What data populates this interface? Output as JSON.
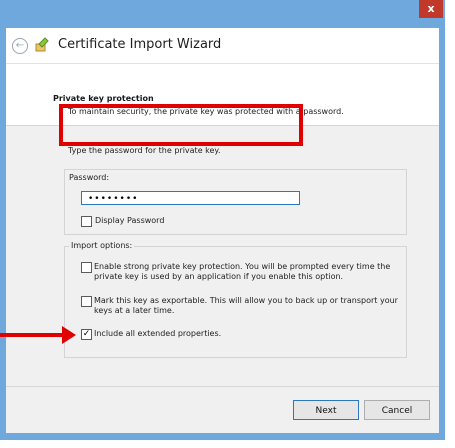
{
  "window": {
    "close_glyph": "x",
    "title": "Certificate Import Wizard",
    "back_glyph": "←"
  },
  "header_panel": {
    "title": "Private key protection",
    "description": "To maintain security, the private key was protected with a password."
  },
  "password_section": {
    "prompt": "Type the password for the private key.",
    "label": "Password:",
    "value": "••••••••",
    "display_password_label": "Display Password",
    "display_password_checked": false
  },
  "import_options": {
    "group_label": "Import options:",
    "options": [
      {
        "line1": "Enable strong private key protection. You will be prompted every time the",
        "line2": "private key is used by an application if you enable this option.",
        "checked": false
      },
      {
        "line1": "Mark this key as exportable. This will allow you to back up or transport your",
        "line2": "keys at a later time.",
        "checked": false
      },
      {
        "line1": "Include all extended properties.",
        "line2": "",
        "checked": true
      }
    ]
  },
  "footer": {
    "next_label": "Next",
    "cancel_label": "Cancel"
  },
  "annotation_color": "#e00000",
  "accent_color": "#6fa8dc"
}
